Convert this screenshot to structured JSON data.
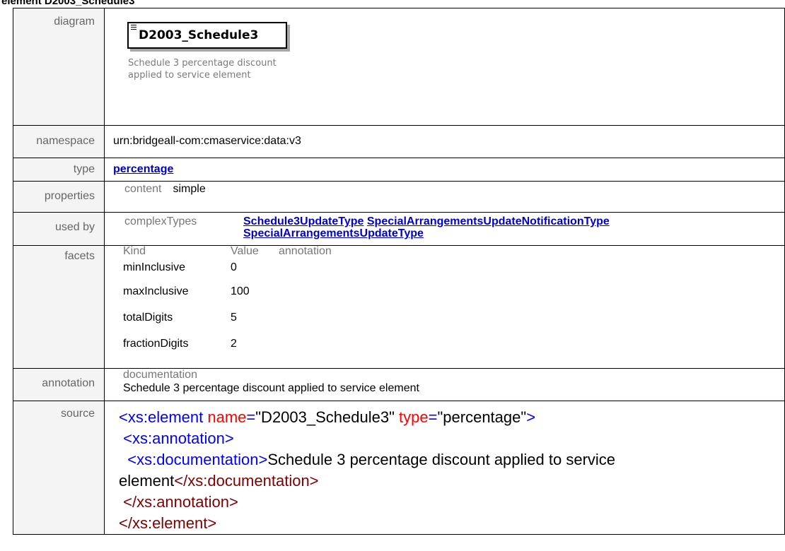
{
  "page": {
    "heading": "element D2003_Schedule3"
  },
  "labels": {
    "diagram": "diagram",
    "namespace": "namespace",
    "type": "type",
    "properties": "properties",
    "used_by": "used by",
    "facets": "facets",
    "annotation": "annotation",
    "source": "source"
  },
  "diagram": {
    "element_name": "D2003_Schedule3",
    "description": "Schedule 3 percentage discount applied to service element"
  },
  "namespace": "urn:bridgeall-com:cmaservice:data:v3",
  "type": {
    "link": "percentage"
  },
  "properties": {
    "key": "content",
    "value": "simple"
  },
  "used_by": {
    "key": "complexTypes",
    "links": [
      "Schedule3UpdateType",
      "SpecialArrangementsUpdateNotificationType",
      "SpecialArrangementsUpdateType"
    ]
  },
  "facets": {
    "headers": [
      "Kind",
      "Value",
      "annotation"
    ],
    "rows": [
      {
        "kind": "minInclusive",
        "value": "0"
      },
      {
        "kind": "maxInclusive",
        "value": "100"
      },
      {
        "kind": "totalDigits",
        "value": "5"
      },
      {
        "kind": "fractionDigits",
        "value": "2"
      }
    ]
  },
  "annotation": {
    "key": "documentation",
    "text": "Schedule 3 percentage discount applied to service element"
  },
  "source": {
    "el_open": "<xs:element",
    "attr_name": " name",
    "eq": "=",
    "name_val": "\"D2003_Schedule3\"",
    "attr_type": " type",
    "type_val": "\"percentage\"",
    "gt": ">",
    "anno_open": "<xs:annotation>",
    "doc_open": "<xs:documentation>",
    "doc_text_1": "Schedule 3 percentage discount applied to service",
    "doc_text_2": "element",
    "doc_close": "</xs:documentation>",
    "anno_close": "</xs:annotation>",
    "el_close": "</xs:element>"
  },
  "colors": {
    "tag": "#0000ff",
    "attr": "#ff0000",
    "close": "#800000",
    "link": "#0000cc",
    "label_bg": "#f4f4f4"
  }
}
